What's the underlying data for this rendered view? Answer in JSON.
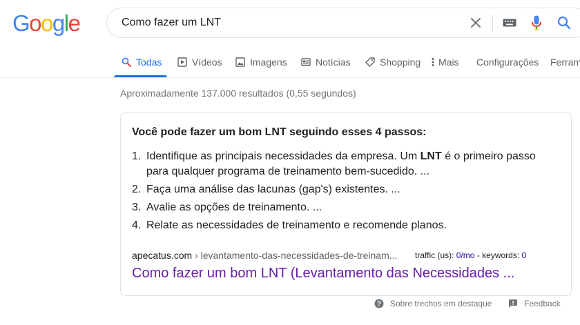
{
  "logo": {
    "letters": [
      "G",
      "o",
      "o",
      "g",
      "l",
      "e"
    ],
    "colors": [
      "#4285f4",
      "#ea4335",
      "#fbbc05",
      "#4285f4",
      "#34a853",
      "#ea4335"
    ]
  },
  "search": {
    "query": "Como fazer um LNT",
    "icons": [
      "clear-icon",
      "keyboard-icon",
      "microphone-icon",
      "search-icon"
    ]
  },
  "tabs": [
    {
      "label": "Todas",
      "icon": "search-icon",
      "active": true
    },
    {
      "label": "Vídeos",
      "icon": "video-icon",
      "active": false
    },
    {
      "label": "Imagens",
      "icon": "image-icon",
      "active": false
    },
    {
      "label": "Notícias",
      "icon": "news-icon",
      "active": false
    },
    {
      "label": "Shopping",
      "icon": "tag-icon",
      "active": false
    },
    {
      "label": "Mais",
      "icon": "more-vert-icon",
      "active": false
    },
    {
      "label": "Configurações",
      "icon": "",
      "active": false
    },
    {
      "label": "Ferram",
      "icon": "",
      "active": false
    }
  ],
  "result_stats": "Aproximadamente 137.000 resultados (0,55 segundos)",
  "snippet": {
    "title": "Você pode fazer um bom LNT seguindo esses 4 passos:",
    "steps": [
      {
        "num": "1.",
        "before": "Identifique as principais necessidades da empresa. Um ",
        "bold": "LNT",
        "after": " é o primeiro passo para qualquer programa de treinamento bem-sucedido. ..."
      },
      {
        "num": "2.",
        "text": "Faça uma análise das lacunas (gap's) existentes. ..."
      },
      {
        "num": "3.",
        "text": "Avalie as opções de treinamento. ..."
      },
      {
        "num": "4.",
        "text": "Relate as necessidades de treinamento e recomende planos."
      }
    ],
    "source_domain": "apecatus.com",
    "source_path": " › levantamento-das-necessidades-de-treinam...",
    "seo": {
      "traffic_label": "traffic (us): ",
      "traffic_value": "0/mo",
      "sep": " - ",
      "keywords_label": "keywords: ",
      "keywords_value": "0"
    },
    "link_title": "Como fazer um bom LNT (Levantamento das Necessidades ..."
  },
  "footer": {
    "about_label": "Sobre trechos em destaque",
    "feedback_label": "Feedback"
  },
  "colors": {
    "accent": "#1a73e8",
    "visited_link": "#681da8",
    "link": "#1a0dab",
    "muted": "#70757a"
  }
}
